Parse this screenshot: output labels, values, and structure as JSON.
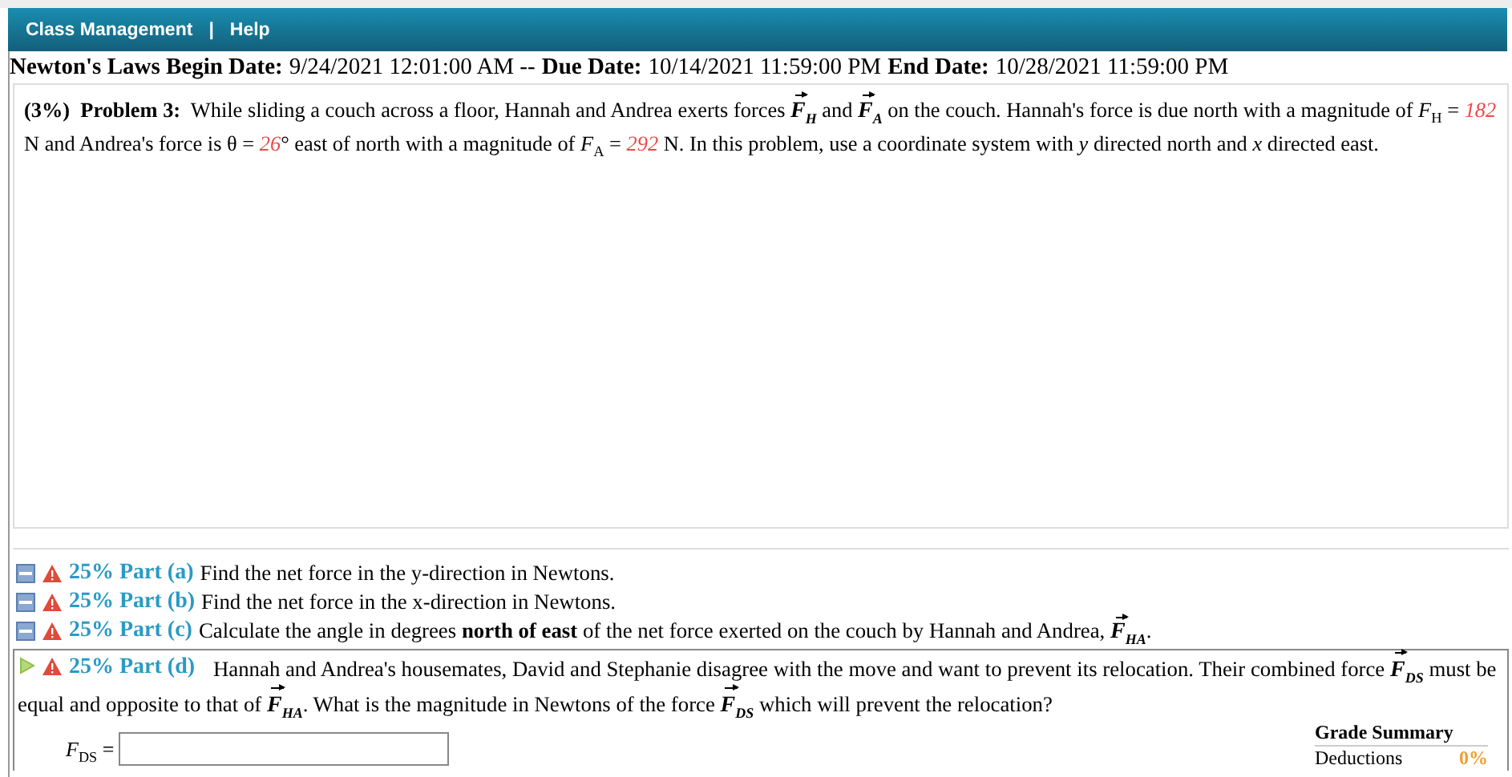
{
  "menu": [
    {
      "label": "Class Management"
    },
    {
      "label": "Help"
    }
  ],
  "menu_separator": "|",
  "header": [
    {
      "text": "Newton's Laws Begin Date:",
      "kind": "label"
    },
    {
      "text": "9/24/2021 12:01:00 AM --",
      "kind": "value"
    },
    {
      "text": "Due Date:",
      "kind": "label"
    },
    {
      "text": "10/14/2021 11:59:00 PM",
      "kind": "value"
    },
    {
      "text": "End Date:",
      "kind": "label"
    },
    {
      "text": "10/28/2021 11:59:00 PM",
      "kind": "value"
    }
  ],
  "problem": {
    "weight": "(3%)",
    "title": "Problem 3:",
    "segments": [
      {
        "text": "While sliding a couch across a floor, Hannah and Andrea exerts forces",
        "kind": "text"
      },
      {
        "text": "F",
        "sub": "H",
        "kind": "vector"
      },
      {
        "text": "and",
        "kind": "text"
      },
      {
        "text": "F",
        "sub": "A",
        "kind": "vector"
      },
      {
        "text": "on the couch. Hannah's force is due north with a magnitude of *F*$_{H}$ =",
        "kind": "text"
      },
      {
        "text": "182",
        "kind": "value"
      },
      {
        "text": "N and Andrea's force is θ =",
        "kind": "text"
      },
      {
        "text": "26",
        "kind": "value"
      },
      {
        "text": "° east of north with a magnitude of *F*$_{A}$ =",
        "kind": "text"
      },
      {
        "text": "292",
        "kind": "value"
      },
      {
        "text": "N. In this problem, use a coordinate system with *y* directed north and *x* directed east.",
        "kind": "text"
      }
    ]
  },
  "parts": [
    {
      "label": "25% Part (a)",
      "expanded": false,
      "segments": [
        {
          "text": "Find the net force in the y-direction in Newtons.",
          "kind": "text"
        }
      ]
    },
    {
      "label": "25% Part (b)",
      "expanded": false,
      "segments": [
        {
          "text": "Find the net force in the x-direction in Newtons.",
          "kind": "text"
        }
      ]
    },
    {
      "label": "25% Part (c)",
      "expanded": false,
      "segments": [
        {
          "text": "Calculate the angle in degrees **north of east** of the net force exerted on the couch by Hannah and Andrea,",
          "kind": "text"
        },
        {
          "text": "F",
          "sub": "HA",
          "kind": "vector"
        },
        {
          "text": ".",
          "kind": "text"
        }
      ]
    },
    {
      "label": "25% Part (d)",
      "expanded": true,
      "segments": [
        {
          "text": "Hannah and Andrea's housemates, David and Stephanie disagree with the move and want to prevent its relocation. Their combined force",
          "kind": "text"
        },
        {
          "text": "F",
          "sub": "DS",
          "kind": "vector"
        },
        {
          "text": "must be equal and opposite to that of",
          "kind": "text"
        },
        {
          "text": "F",
          "sub": "HA",
          "kind": "vector"
        },
        {
          "text": ". What is the magnitude in Newtons of the force",
          "kind": "text"
        },
        {
          "text": "F",
          "sub": "DS",
          "kind": "vector"
        },
        {
          "text": "which will prevent the relocation?",
          "kind": "text"
        }
      ]
    }
  ],
  "answer": {
    "label": "*F*$_{DS}$ ="
  },
  "grade_summary": {
    "title": "Grade Summary",
    "rows": [
      {
        "label": "Deductions",
        "value": "0%"
      }
    ]
  }
}
